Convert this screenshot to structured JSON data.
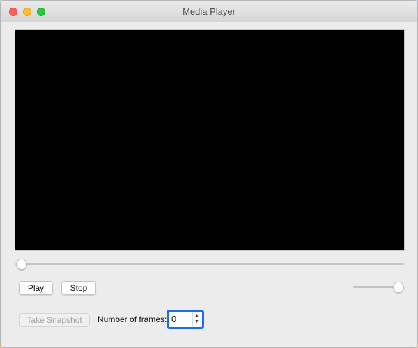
{
  "window": {
    "title": "Media Player"
  },
  "controls": {
    "play_label": "Play",
    "stop_label": "Stop",
    "snapshot_label": "Take Snapshot",
    "frames_label": "Number of frames:",
    "frames_value": "0"
  },
  "seek": {
    "position": 0.0
  },
  "volume": {
    "level": 1.0
  },
  "colors": {
    "video_background": "#000000",
    "focus_ring": "#1a6fe8",
    "close": "#fe5f57",
    "minimize": "#febc2e",
    "maximize": "#28c840"
  },
  "icons": {
    "stepper": "stepper-up-down-icon"
  }
}
